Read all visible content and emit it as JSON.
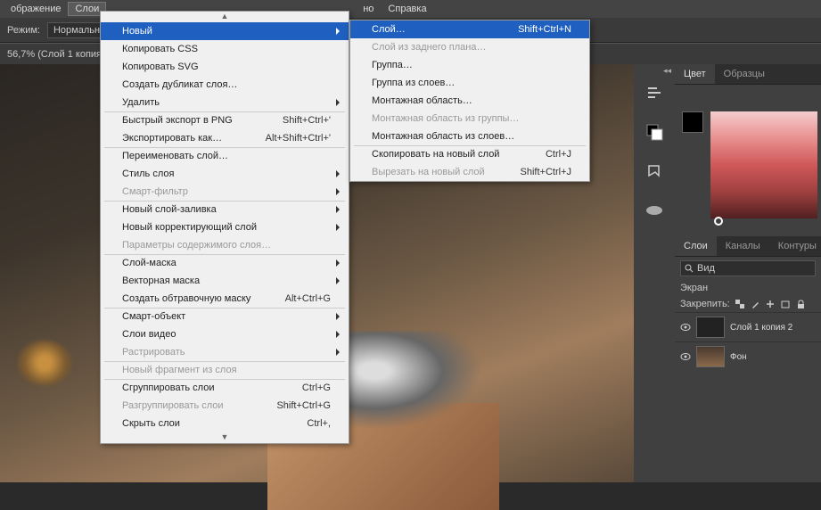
{
  "topmenu": {
    "item0": "ображение",
    "item1": "Слои",
    "item2": "но",
    "item3": "Справка"
  },
  "options": {
    "mode_label": "Режим:",
    "mode_value": "Нормальн"
  },
  "doc_title": "56,7% (Слой 1 копия",
  "menu": {
    "new": "Новый",
    "copy_css": "Копировать CSS",
    "copy_svg": "Копировать SVG",
    "duplicate": "Создать дубликат слоя…",
    "delete": "Удалить",
    "quick_export": "Быстрый экспорт в PNG",
    "quick_export_sc": "Shift+Ctrl+'",
    "export_as": "Экспортировать как…",
    "export_as_sc": "Alt+Shift+Ctrl+'",
    "rename": "Переименовать слой…",
    "layer_style": "Стиль слоя",
    "smart_filter": "Смарт-фильтр",
    "new_fill": "Новый слой-заливка",
    "new_adj": "Новый корректирующий слой",
    "content_opts": "Параметры содержимого слоя…",
    "layer_mask": "Слой-маска",
    "vector_mask": "Векторная маска",
    "clipping": "Создать обтравочную маску",
    "clipping_sc": "Alt+Ctrl+G",
    "smart_obj": "Смарт-объект",
    "video": "Слои видео",
    "raster": "Растрировать",
    "new_from_layer": "Новый фрагмент из слоя",
    "group": "Сгруппировать слои",
    "group_sc": "Ctrl+G",
    "ungroup": "Разгруппировать слои",
    "ungroup_sc": "Shift+Ctrl+G",
    "hide": "Скрыть слои",
    "hide_sc": "Ctrl+,"
  },
  "submenu": {
    "layer": "Слой…",
    "layer_sc": "Shift+Ctrl+N",
    "from_bg": "Слой из заднего плана…",
    "group": "Группа…",
    "group_from": "Группа из слоев…",
    "artboard": "Монтажная область…",
    "artboard_group": "Монтажная область из группы…",
    "artboard_layers": "Монтажная область из слоев…",
    "copy_layer": "Скопировать на новый слой",
    "copy_layer_sc": "Ctrl+J",
    "cut_layer": "Вырезать на новый слой",
    "cut_layer_sc": "Shift+Ctrl+J"
  },
  "panels": {
    "color_tab": "Цвет",
    "swatches_tab": "Образцы",
    "layers_tab": "Слои",
    "channels_tab": "Каналы",
    "paths_tab": "Контуры",
    "filter_kind": "Вид",
    "blend_mode": "Экран",
    "lock_label": "Закрепить:",
    "layer1": "Слой 1 копия 2",
    "layer_bg": "Фон"
  }
}
